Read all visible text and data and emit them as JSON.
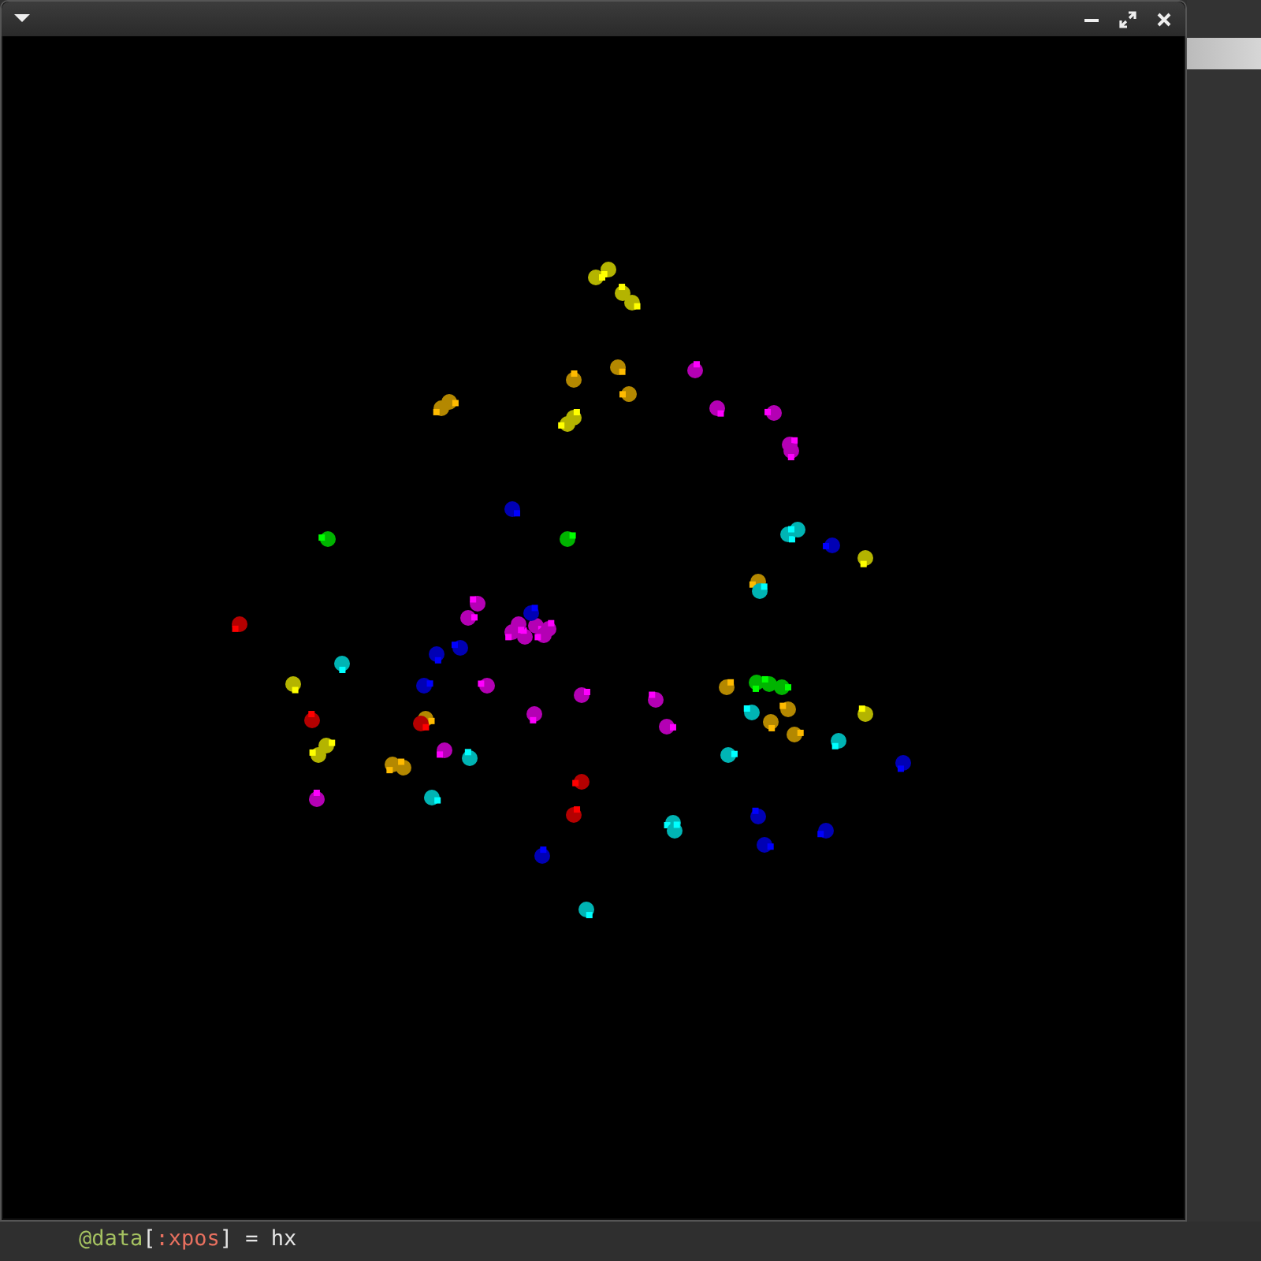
{
  "window": {
    "controls": [
      {
        "kind": "minimize"
      },
      {
        "kind": "maximize"
      },
      {
        "kind": "close"
      }
    ]
  },
  "editor": {
    "lines": [
      {
        "tokens": [
          {
            "kind": "ivar",
            "text": "@data"
          },
          {
            "kind": "punct",
            "text": "["
          },
          {
            "kind": "symbol",
            "text": ":xpos"
          },
          {
            "kind": "plain",
            "text": "] = hx"
          }
        ]
      }
    ]
  }
}
